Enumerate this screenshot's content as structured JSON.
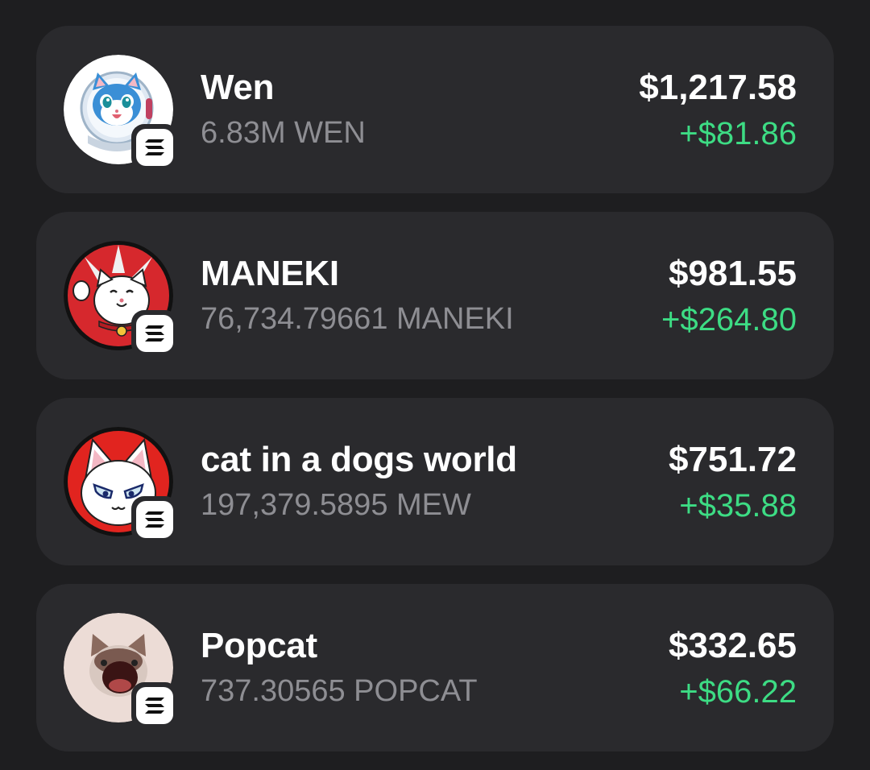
{
  "tokens": [
    {
      "name": "Wen",
      "amount": "6.83M WEN",
      "value": "$1,217.58",
      "change": "+$81.86",
      "icon": "wen-cat-astronaut-icon",
      "chain_icon": "solana-icon"
    },
    {
      "name": "MANEKI",
      "amount": "76,734.79661 MANEKI",
      "value": "$981.55",
      "change": "+$264.80",
      "icon": "maneki-lucky-cat-icon",
      "chain_icon": "solana-icon"
    },
    {
      "name": "cat in a dogs world",
      "amount": "197,379.5895 MEW",
      "value": "$751.72",
      "change": "+$35.88",
      "icon": "mew-cat-icon",
      "chain_icon": "solana-icon"
    },
    {
      "name": "Popcat",
      "amount": "737.30565 POPCAT",
      "value": "$332.65",
      "change": "+$66.22",
      "icon": "popcat-icon",
      "chain_icon": "solana-icon"
    }
  ],
  "colors": {
    "background": "#1e1e20",
    "card": "#2a2a2d",
    "primary_text": "#ffffff",
    "secondary_text": "#8e8e93",
    "positive_change": "#3ddc84"
  }
}
